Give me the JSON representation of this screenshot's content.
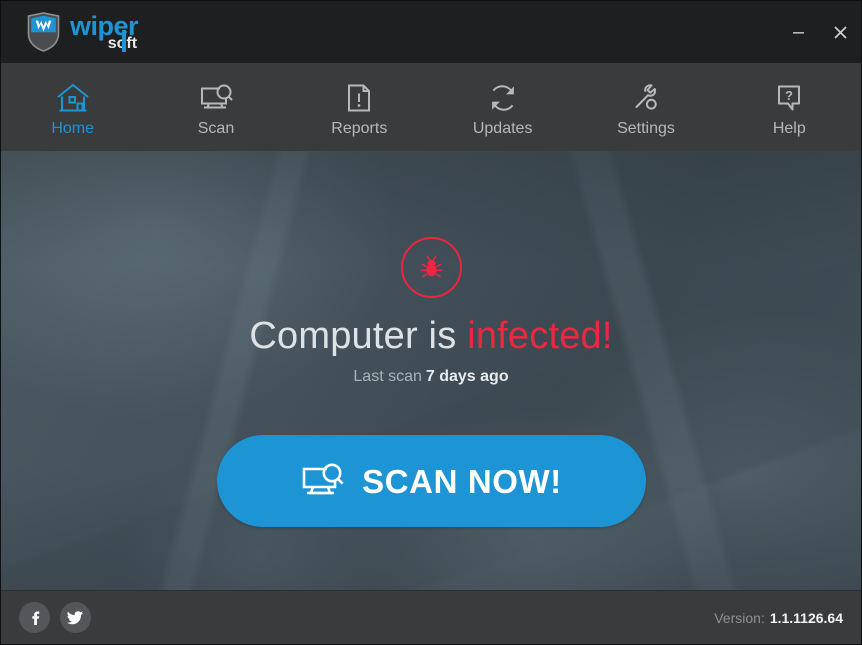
{
  "window": {
    "app_title": "WiperSoft",
    "logo_primary": "wiper",
    "logo_secondary": "soft",
    "minimize_label": "Minimize",
    "close_label": "Close",
    "accent_color": "#1d94d4",
    "danger_color": "#ec2742",
    "titlebar_color": "#1e1f21",
    "navbar_color": "#3a3b3d"
  },
  "nav": {
    "items": [
      {
        "label": "Home",
        "icon": "house-icon",
        "active": true
      },
      {
        "label": "Scan",
        "icon": "monitor-search-icon",
        "active": false
      },
      {
        "label": "Reports",
        "icon": "document-alert-icon",
        "active": false
      },
      {
        "label": "Updates",
        "icon": "refresh-icon",
        "active": false
      },
      {
        "label": "Settings",
        "icon": "wrench-icon",
        "active": false
      },
      {
        "label": "Help",
        "icon": "question-bubble-icon",
        "active": false
      }
    ]
  },
  "hero": {
    "status_icon": "bug-icon",
    "headline_prefix": "Computer is",
    "headline_status": "infected!",
    "last_scan_label": "Last scan",
    "last_scan_value": "7 days ago",
    "scan_button_label": "SCAN NOW!",
    "scan_button_icon": "monitor-search-icon"
  },
  "footer": {
    "social": [
      {
        "name": "facebook",
        "glyph": "f"
      },
      {
        "name": "twitter",
        "glyph": "t"
      }
    ],
    "version_label": "Version:",
    "version_value": "1.1.1126.64"
  }
}
